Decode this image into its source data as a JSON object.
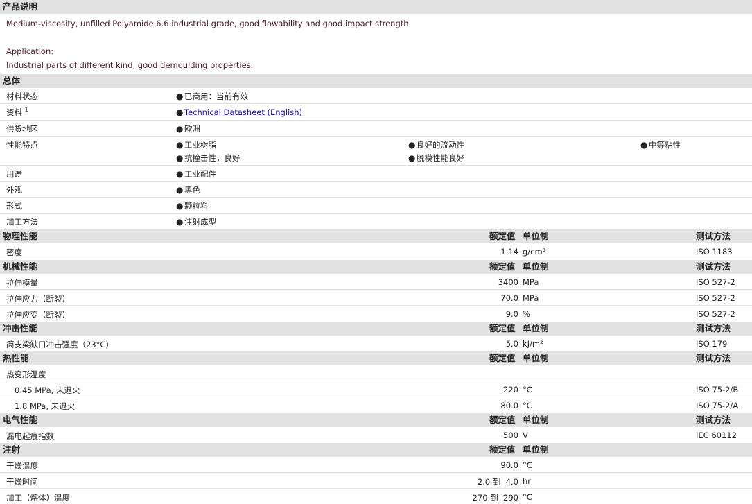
{
  "product_description": {
    "heading": "产品说明",
    "line1": "Medium-viscosity, unfilled Polyamide 6.6 industrial grade, good flowability and good impact strength",
    "application_label": "Application:",
    "application_text": "Industrial parts of different kind, good demoulding properties."
  },
  "general": {
    "heading": "总体",
    "rows": [
      {
        "label": "材料状态",
        "values": [
          "已商用：当前有效"
        ]
      },
      {
        "label": "资料",
        "sup": "1",
        "link": "Technical Datasheet (English)"
      },
      {
        "label": "供货地区",
        "values": [
          "欧洲"
        ]
      },
      {
        "label": "性能特点",
        "values": [
          "工业树脂",
          "良好的流动性",
          "中等粘性",
          "抗撞击性，良好",
          "脱模性能良好"
        ]
      },
      {
        "label": "用途",
        "values": [
          "工业配件"
        ]
      },
      {
        "label": "外观",
        "values": [
          "黑色"
        ]
      },
      {
        "label": "形式",
        "values": [
          "颗粒料"
        ]
      },
      {
        "label": "加工方法",
        "values": [
          "注射成型"
        ]
      }
    ]
  },
  "headers": {
    "nominal": "额定值",
    "unit": "单位制",
    "method": "测试方法"
  },
  "physical": {
    "heading": "物理性能",
    "rows": [
      {
        "label": "密度",
        "value": "1.14",
        "unit": "g/cm³",
        "method": "ISO 1183"
      }
    ]
  },
  "mechanical": {
    "heading": "机械性能",
    "rows": [
      {
        "label": "拉伸模量",
        "value": "3400",
        "unit": "MPa",
        "method": "ISO 527-2"
      },
      {
        "label": "拉伸应力（断裂）",
        "value": "70.0",
        "unit": "MPa",
        "method": "ISO 527-2"
      },
      {
        "label": "拉伸应变（断裂）",
        "value": "9.0",
        "unit": "%",
        "method": "ISO 527-2"
      }
    ]
  },
  "impact": {
    "heading": "冲击性能",
    "rows": [
      {
        "label": "简支梁缺口冲击强度（23°C)",
        "value": "5.0",
        "unit": "kJ/m²",
        "method": "ISO 179"
      }
    ]
  },
  "thermal": {
    "heading": "热性能",
    "rows": [
      {
        "label": "热变形温度",
        "value": "",
        "unit": "",
        "method": ""
      },
      {
        "label": "0.45 MPa, 未退火",
        "value": "220",
        "unit": "°C",
        "method": "ISO 75-2/B"
      },
      {
        "label": "1.8 MPa, 未退火",
        "value": "80.0",
        "unit": "°C",
        "method": "ISO 75-2/A"
      }
    ]
  },
  "electrical": {
    "heading": "电气性能",
    "rows": [
      {
        "label": "漏电起痕指数",
        "value": "500",
        "unit": "V",
        "method": "IEC 60112"
      }
    ]
  },
  "injection": {
    "heading": "注射",
    "rows": [
      {
        "label": "干燥温度",
        "value": "90.0",
        "unit": "°C"
      },
      {
        "label": "干燥时间",
        "value": "2.0 到  4.0",
        "unit": "hr"
      },
      {
        "label": "加工（熔体）温度",
        "value": "270 到  290",
        "unit": "°C"
      }
    ]
  }
}
